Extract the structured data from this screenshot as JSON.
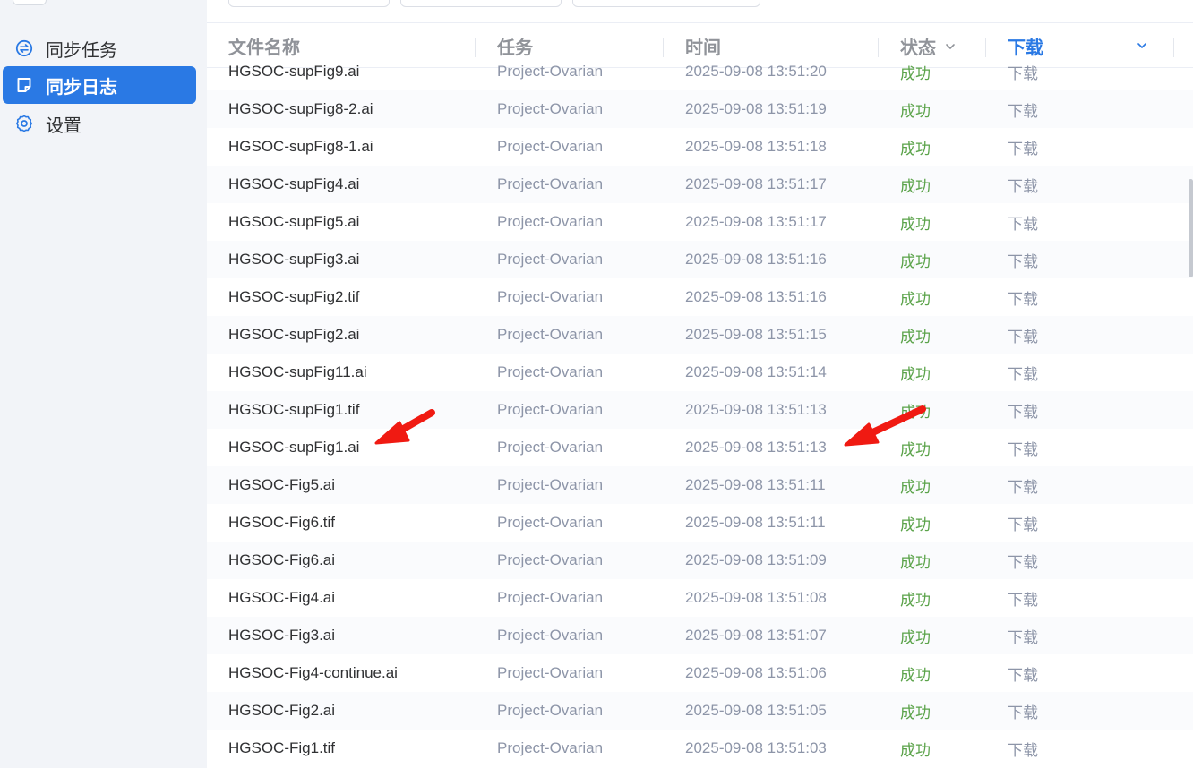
{
  "sidebar": {
    "items": [
      {
        "label": "同步任务",
        "icon": "sync-icon",
        "active": false
      },
      {
        "label": "同步日志",
        "icon": "log-icon",
        "active": true
      },
      {
        "label": "设置",
        "icon": "gear-icon",
        "active": false
      }
    ]
  },
  "table": {
    "columns": {
      "name": "文件名称",
      "task": "任务",
      "time": "时间",
      "status": "状态",
      "type": "下载"
    },
    "rows": [
      {
        "name": "HGSOC-supFig9.ai",
        "task": "Project-Ovarian",
        "time": "2025-09-08 13:51:20",
        "status": "成功",
        "action": "下载"
      },
      {
        "name": "HGSOC-supFig8-2.ai",
        "task": "Project-Ovarian",
        "time": "2025-09-08 13:51:19",
        "status": "成功",
        "action": "下载"
      },
      {
        "name": "HGSOC-supFig8-1.ai",
        "task": "Project-Ovarian",
        "time": "2025-09-08 13:51:18",
        "status": "成功",
        "action": "下载"
      },
      {
        "name": "HGSOC-supFig4.ai",
        "task": "Project-Ovarian",
        "time": "2025-09-08 13:51:17",
        "status": "成功",
        "action": "下载"
      },
      {
        "name": "HGSOC-supFig5.ai",
        "task": "Project-Ovarian",
        "time": "2025-09-08 13:51:17",
        "status": "成功",
        "action": "下载"
      },
      {
        "name": "HGSOC-supFig3.ai",
        "task": "Project-Ovarian",
        "time": "2025-09-08 13:51:16",
        "status": "成功",
        "action": "下载"
      },
      {
        "name": "HGSOC-supFig2.tif",
        "task": "Project-Ovarian",
        "time": "2025-09-08 13:51:16",
        "status": "成功",
        "action": "下载"
      },
      {
        "name": "HGSOC-supFig2.ai",
        "task": "Project-Ovarian",
        "time": "2025-09-08 13:51:15",
        "status": "成功",
        "action": "下载"
      },
      {
        "name": "HGSOC-supFig11.ai",
        "task": "Project-Ovarian",
        "time": "2025-09-08 13:51:14",
        "status": "成功",
        "action": "下载"
      },
      {
        "name": "HGSOC-supFig1.tif",
        "task": "Project-Ovarian",
        "time": "2025-09-08 13:51:13",
        "status": "成功",
        "action": "下载"
      },
      {
        "name": "HGSOC-supFig1.ai",
        "task": "Project-Ovarian",
        "time": "2025-09-08 13:51:13",
        "status": "成功",
        "action": "下载"
      },
      {
        "name": "HGSOC-Fig5.ai",
        "task": "Project-Ovarian",
        "time": "2025-09-08 13:51:11",
        "status": "成功",
        "action": "下载"
      },
      {
        "name": "HGSOC-Fig6.tif",
        "task": "Project-Ovarian",
        "time": "2025-09-08 13:51:11",
        "status": "成功",
        "action": "下载"
      },
      {
        "name": "HGSOC-Fig6.ai",
        "task": "Project-Ovarian",
        "time": "2025-09-08 13:51:09",
        "status": "成功",
        "action": "下载"
      },
      {
        "name": "HGSOC-Fig4.ai",
        "task": "Project-Ovarian",
        "time": "2025-09-08 13:51:08",
        "status": "成功",
        "action": "下载"
      },
      {
        "name": "HGSOC-Fig3.ai",
        "task": "Project-Ovarian",
        "time": "2025-09-08 13:51:07",
        "status": "成功",
        "action": "下载"
      },
      {
        "name": "HGSOC-Fig4-continue.ai",
        "task": "Project-Ovarian",
        "time": "2025-09-08 13:51:06",
        "status": "成功",
        "action": "下载"
      },
      {
        "name": "HGSOC-Fig2.ai",
        "task": "Project-Ovarian",
        "time": "2025-09-08 13:51:05",
        "status": "成功",
        "action": "下载"
      },
      {
        "name": "HGSOC-Fig1.tif",
        "task": "Project-Ovarian",
        "time": "2025-09-08 13:51:03",
        "status": "成功",
        "action": "下载"
      }
    ]
  },
  "colors": {
    "accent": "#2a79e4",
    "success": "#5ba34a",
    "muted": "#8d95a8",
    "annotation": "#f01a12"
  }
}
